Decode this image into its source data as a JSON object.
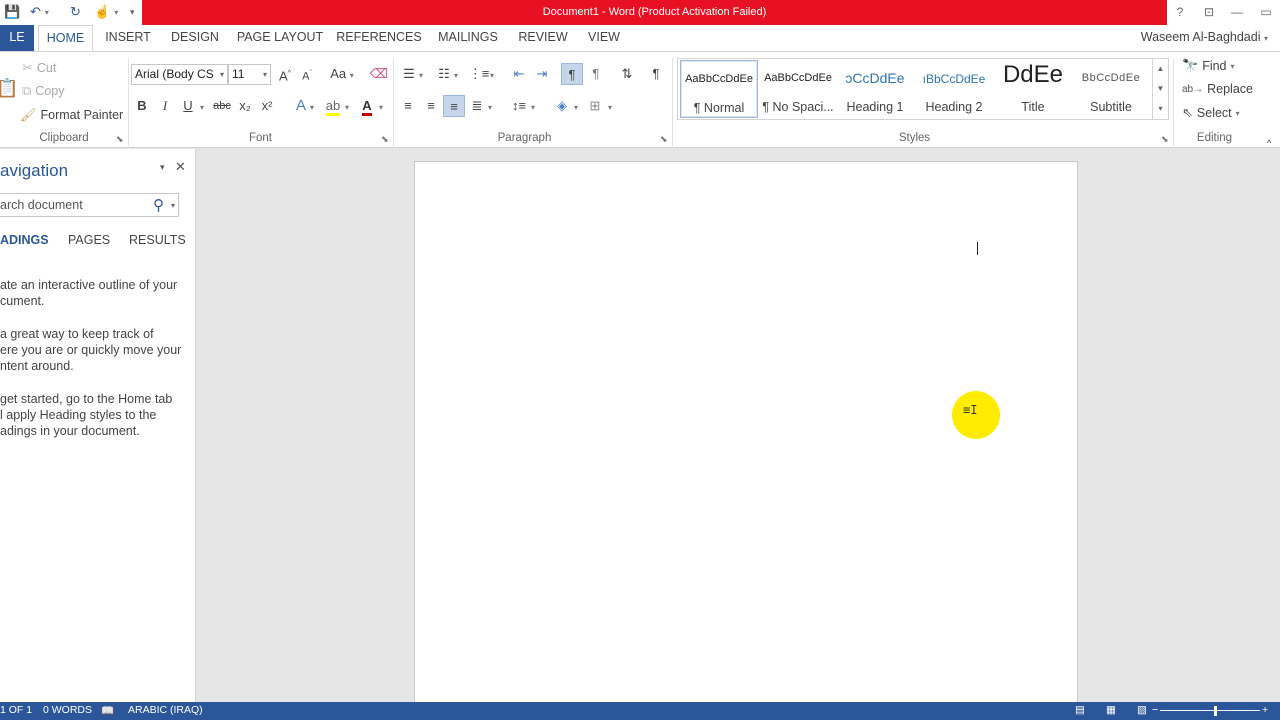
{
  "window": {
    "title": "Document1 - Word (Product Activation Failed)",
    "controls": {
      "help": "?",
      "ribbon_display": "⊡",
      "minimize": "—",
      "restore": "▭"
    }
  },
  "qat": {
    "save_icon": "save-icon",
    "undo_icon": "undo-icon",
    "redo_icon": "redo-icon",
    "touch_icon": "touch-mode-icon"
  },
  "tabs": {
    "file": "LE",
    "items": [
      "HOME",
      "INSERT",
      "DESIGN",
      "PAGE LAYOUT",
      "REFERENCES",
      "MAILINGS",
      "REVIEW",
      "VIEW"
    ],
    "active": "HOME",
    "user": "Waseem Al-Baghdadi"
  },
  "ribbon": {
    "clipboard": {
      "cut": "Cut",
      "copy": "Copy",
      "format_painter": "Format Painter",
      "label": "Clipboard"
    },
    "font": {
      "family": "Arial (Body CS",
      "size": "11",
      "grow": "A",
      "shrink": "A",
      "case": "Aa",
      "bold": "B",
      "italic": "I",
      "underline": "U",
      "strike": "abc",
      "subscript": "x₂",
      "superscript": "x²",
      "label": "Font",
      "font_color": "#c00000",
      "highlight_color": "#ffff00"
    },
    "paragraph": {
      "label": "Paragraph"
    },
    "styles": {
      "label": "Styles",
      "items": [
        {
          "sample": "AaBbCcDdEe",
          "name": "¶ Normal"
        },
        {
          "sample": "AaBbCcDdEe",
          "name": "¶ No Spaci..."
        },
        {
          "sample": "ɔCcDdEe",
          "name": "Heading 1"
        },
        {
          "sample": "ıBbCcDdEe",
          "name": "Heading 2"
        },
        {
          "sample": "DdEe",
          "name": "Title"
        },
        {
          "sample": "BbCcDdEe",
          "name": "Subtitle"
        }
      ]
    },
    "editing": {
      "find": "Find",
      "replace": "Replace",
      "select": "Select",
      "label": "Editing"
    }
  },
  "navigation": {
    "title": "avigation",
    "search_placeholder": "arch document",
    "tabs": [
      "ADINGS",
      "PAGES",
      "RESULTS"
    ],
    "paragraphs": [
      [
        "ate an interactive outline of your",
        "cument."
      ],
      [
        "a great way to keep track of",
        "ere you are or quickly move your",
        "ntent around."
      ],
      [
        "get started, go to the Home tab",
        "l apply Heading styles to the",
        "adings in your document."
      ]
    ]
  },
  "statusbar": {
    "page": "1 OF 1",
    "words": "0 WORDS",
    "language": "ARABIC (IRAQ)"
  },
  "colors": {
    "accent": "#2b579a",
    "title_bar_alert": "#e81123",
    "cursor_highlight": "#ffec00"
  }
}
